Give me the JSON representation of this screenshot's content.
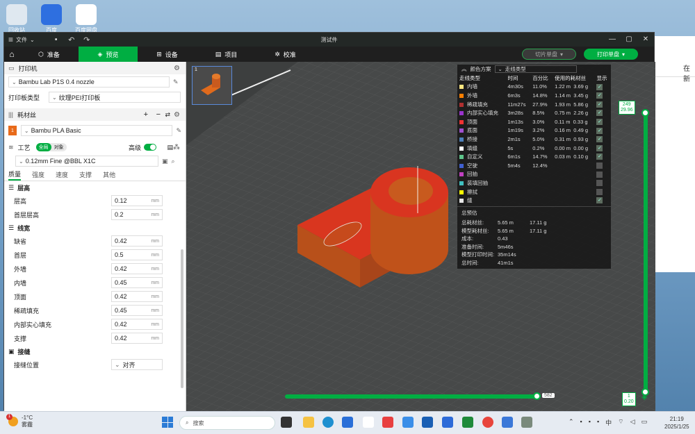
{
  "desktop": {
    "icons": [
      {
        "label": "回收站"
      },
      {
        "label": "百度"
      },
      {
        "label": "百度网盘"
      }
    ]
  },
  "background_window": {
    "text": "在 新"
  },
  "window": {
    "title": "测试件",
    "file_menu": "文件"
  },
  "nav": {
    "tabs": [
      {
        "label": "准备",
        "icon": "⬡"
      },
      {
        "label": "预览",
        "icon": "⬡"
      },
      {
        "label": "设备",
        "icon": "⚙"
      },
      {
        "label": "项目",
        "icon": "▤"
      },
      {
        "label": "校准",
        "icon": "✲"
      }
    ],
    "slice_label": "切片单盘",
    "print_label": "打印单盘"
  },
  "printer": {
    "section": "打印机",
    "name": "Bambu Lab P1S 0.4 nozzle",
    "plate_label": "打印板类型",
    "plate_value": "纹理PEI打印板"
  },
  "filament": {
    "section": "耗材丝",
    "slot": "1",
    "name": "Bambu PLA Basic"
  },
  "process": {
    "section": "工艺",
    "pill_global": "全局",
    "pill_object": "对象",
    "advanced": "高级",
    "preset": "0.12mm Fine @BBL X1C",
    "tabs": [
      "质量",
      "强度",
      "速度",
      "支撑",
      "其他"
    ],
    "groups": [
      {
        "title": "层高",
        "params": [
          {
            "label": "层高",
            "value": "0.12",
            "unit": "mm"
          },
          {
            "label": "首层层高",
            "value": "0.2",
            "unit": "mm"
          }
        ]
      },
      {
        "title": "线宽",
        "params": [
          {
            "label": "缺省",
            "value": "0.42",
            "unit": "mm"
          },
          {
            "label": "首层",
            "value": "0.5",
            "unit": "mm"
          },
          {
            "label": "外墙",
            "value": "0.42",
            "unit": "mm"
          },
          {
            "label": "内墙",
            "value": "0.45",
            "unit": "mm"
          },
          {
            "label": "顶面",
            "value": "0.42",
            "unit": "mm"
          },
          {
            "label": "稀疏填充",
            "value": "0.45",
            "unit": "mm"
          },
          {
            "label": "内部实心填充",
            "value": "0.42",
            "unit": "mm"
          },
          {
            "label": "支撑",
            "value": "0.42",
            "unit": "mm"
          }
        ]
      },
      {
        "title": "接缝",
        "params": [
          {
            "label": "接缝位置",
            "value": "对齐",
            "unit": ""
          }
        ]
      }
    ]
  },
  "legend": {
    "title": "颜色方案",
    "scheme": "走线类型",
    "headers": [
      "走线类型",
      "时间",
      "百分比",
      "使用的耗材丝",
      "显示"
    ],
    "rows": [
      {
        "name": "内墙",
        "color": "#ffe680",
        "time": "4m30s",
        "pct": "11.0%",
        "len": "1.22 m",
        "wt": "3.69 g",
        "show": true
      },
      {
        "name": "外墙",
        "color": "#ff7f00",
        "time": "6m3s",
        "pct": "14.8%",
        "len": "1.14 m",
        "wt": "3.45 g",
        "show": true
      },
      {
        "name": "稀疏填充",
        "color": "#b03030",
        "time": "11m27s",
        "pct": "27.9%",
        "len": "1.93 m",
        "wt": "5.86 g",
        "show": true
      },
      {
        "name": "内部实心填充",
        "color": "#9933cc",
        "time": "3m28s",
        "pct": "8.5%",
        "len": "0.75 m",
        "wt": "2.26 g",
        "show": true
      },
      {
        "name": "顶面",
        "color": "#f03232",
        "time": "1m13s",
        "pct": "3.0%",
        "len": "0.11 m",
        "wt": "0.33 g",
        "show": true
      },
      {
        "name": "底面",
        "color": "#a050d0",
        "time": "1m19s",
        "pct": "3.2%",
        "len": "0.16 m",
        "wt": "0.49 g",
        "show": true
      },
      {
        "name": "桥接",
        "color": "#4d80ba",
        "time": "2m1s",
        "pct": "5.0%",
        "len": "0.31 m",
        "wt": "0.93 g",
        "show": true
      },
      {
        "name": "填缝",
        "color": "#ffffff",
        "time": "5s",
        "pct": "0.2%",
        "len": "0.00 m",
        "wt": "0.00 g",
        "show": true
      },
      {
        "name": "自定义",
        "color": "#5ec48a",
        "time": "6m1s",
        "pct": "14.7%",
        "len": "0.03 m",
        "wt": "0.10 g",
        "show": true
      },
      {
        "name": "空驶",
        "color": "#4060d0",
        "time": "5m4s",
        "pct": "12.4%",
        "len": "",
        "wt": "",
        "show": false
      },
      {
        "name": "回抽",
        "color": "#c040c0",
        "time": "",
        "pct": "",
        "len": "",
        "wt": "",
        "show": false
      },
      {
        "name": "装填回抽",
        "color": "#40c0c0",
        "time": "",
        "pct": "",
        "len": "",
        "wt": "",
        "show": false
      },
      {
        "name": "擦拭",
        "color": "#ffff00",
        "time": "",
        "pct": "",
        "len": "",
        "wt": "",
        "show": false
      },
      {
        "name": "缝",
        "color": "#e6e6e6",
        "time": "",
        "pct": "",
        "len": "",
        "wt": "",
        "show": true
      }
    ],
    "summary_title": "总预估",
    "summary": [
      {
        "k": "总耗材丝:",
        "a": "5.65 m",
        "b": "17.11 g"
      },
      {
        "k": "模型耗材丝:",
        "a": "5.65 m",
        "b": "17.11 g"
      },
      {
        "k": "成本:",
        "a": "0.43",
        "b": ""
      },
      {
        "k": "准备时间:",
        "a": "5m46s",
        "b": ""
      },
      {
        "k": "模型打印时间:",
        "a": "35m14s",
        "b": ""
      },
      {
        "k": "总时间:",
        "a": "41m1s",
        "b": ""
      }
    ]
  },
  "layer_slider": {
    "top_layer": "249",
    "top_height": "29.96",
    "bottom_layer": "1",
    "bottom_height": "0.20"
  },
  "move_slider": {
    "value": "582"
  },
  "plate_thumb": {
    "number": "1"
  },
  "taskbar": {
    "temp": "-1°C",
    "weather": "雾霾",
    "search": "搜索",
    "lang": "中",
    "time": "21:19",
    "date": "2025/1/25",
    "badge": "1"
  }
}
